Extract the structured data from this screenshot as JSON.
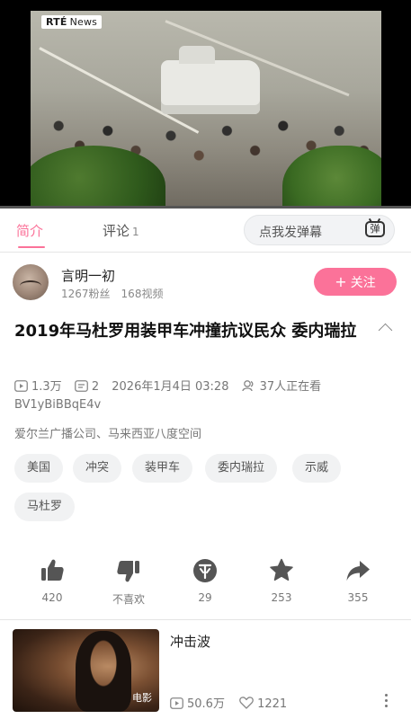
{
  "video": {
    "channel_logo": "RTÉ",
    "channel_logo_sub": "News",
    "progress_percent": 0
  },
  "tabs": {
    "intro": "简介",
    "comments": "评论",
    "comments_count": "1"
  },
  "danmaku": {
    "placeholder": "点我发弹幕",
    "toggle_label": "弹"
  },
  "uploader": {
    "name": "言明一初",
    "fans": "1267粉丝",
    "videos": "168视频",
    "follow_label": "关注",
    "follow_plus": "+"
  },
  "title": "2019年马杜罗用装甲车冲撞抗议民众 委内瑞拉",
  "meta": {
    "views": "1.3万",
    "danmaku_count": "2",
    "date": "2026年1月4日 03:28",
    "watching": "37人正在看",
    "bvid": "BV1yBiBBqE4v",
    "source": "爱尔兰广播公司、马来西亚八度空间"
  },
  "tags": [
    "美国",
    "冲突",
    "装甲车",
    "委内瑞拉",
    "示威",
    "马杜罗"
  ],
  "actions": {
    "like": "420",
    "dislike": "不喜欢",
    "coin": "29",
    "favorite": "253",
    "share": "355"
  },
  "related": {
    "title": "冲击波",
    "badge": "电影",
    "views": "50.6万",
    "comments": "1221"
  },
  "colors": {
    "accent": "#fb7299",
    "icon": "#555555"
  }
}
